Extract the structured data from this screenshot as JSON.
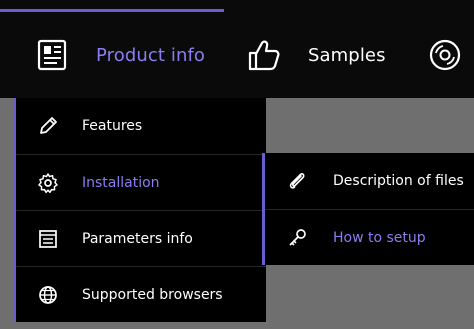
{
  "topnav": {
    "items": [
      {
        "label": "Product info",
        "icon": "document-icon",
        "active": true
      },
      {
        "label": "Samples",
        "icon": "thumbs-up-icon",
        "active": false
      },
      {
        "label": "",
        "icon": "disc-icon",
        "active": false
      }
    ]
  },
  "dropdown": {
    "items": [
      {
        "label": "Features",
        "icon": "pencil-icon"
      },
      {
        "label": "Installation",
        "icon": "gear-icon",
        "active": true
      },
      {
        "label": "Parameters info",
        "icon": "list-icon"
      },
      {
        "label": "Supported browsers",
        "icon": "globe-icon"
      }
    ]
  },
  "submenu": {
    "items": [
      {
        "label": "Description of files",
        "icon": "paperclip-icon"
      },
      {
        "label": "How to setup",
        "icon": "key-icon",
        "active": true
      }
    ]
  },
  "colors": {
    "accent": "#6a5dd0",
    "active_text": "#8a7df0",
    "bar_bg": "#0a0a0a",
    "page_bg": "#6f6f6f"
  }
}
